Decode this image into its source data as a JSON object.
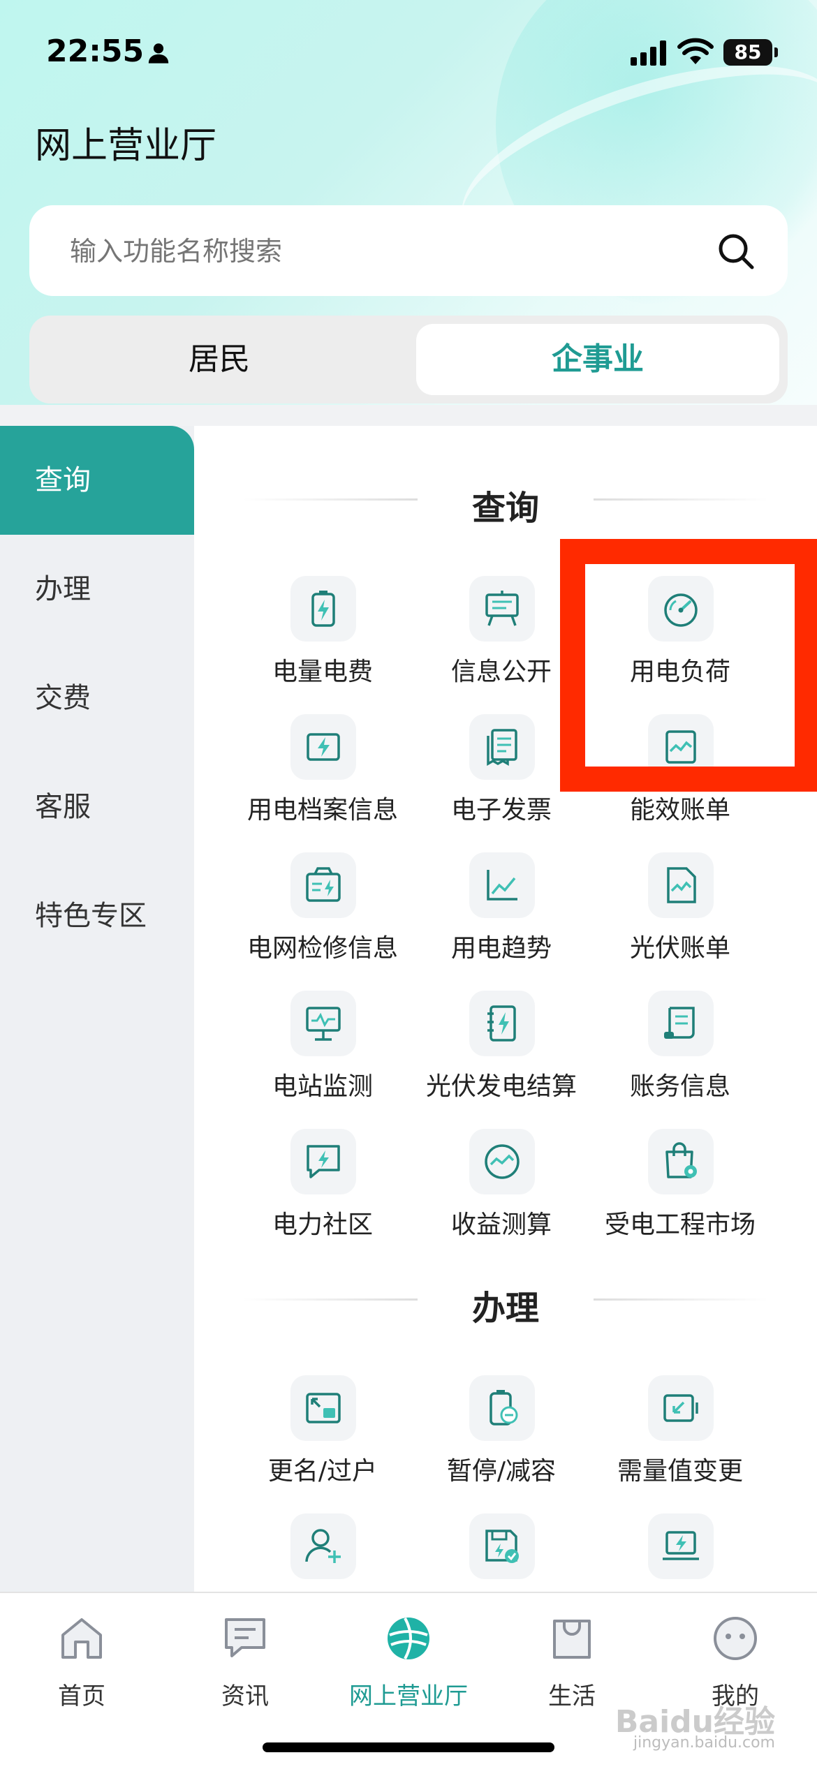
{
  "status_bar": {
    "time": "22:55",
    "battery": "85"
  },
  "page_title": "网上营业厅",
  "search": {
    "placeholder": "输入功能名称搜索"
  },
  "segments": [
    "居民",
    "企事业"
  ],
  "sidebar": {
    "items": [
      "查询",
      "办理",
      "交费",
      "客服",
      "特色专区"
    ],
    "active": "查询"
  },
  "sections": [
    {
      "title": "查询",
      "items": [
        {
          "label": "电量电费",
          "icon": "battery-bolt-icon"
        },
        {
          "label": "信息公开",
          "icon": "easel-board-icon"
        },
        {
          "label": "用电负荷",
          "icon": "speedometer-icon"
        },
        {
          "label": "用电档案信息",
          "icon": "file-bolt-icon"
        },
        {
          "label": "电子发票",
          "icon": "invoice-icon"
        },
        {
          "label": "能效账单",
          "icon": "efficiency-bill-icon"
        },
        {
          "label": "电网检修信息",
          "icon": "maintenance-folder-icon"
        },
        {
          "label": "用电趋势",
          "icon": "trend-chart-icon"
        },
        {
          "label": "光伏账单",
          "icon": "pv-bill-icon"
        },
        {
          "label": "电站监测",
          "icon": "monitor-screen-icon"
        },
        {
          "label": "光伏发电结算",
          "icon": "ledger-bolt-icon"
        },
        {
          "label": "账务信息",
          "icon": "scroll-document-icon"
        },
        {
          "label": "电力社区",
          "icon": "chat-bolt-icon"
        },
        {
          "label": "收益测算",
          "icon": "earnings-gauge-icon"
        },
        {
          "label": "受电工程市场",
          "icon": "shopping-bag-gear-icon"
        }
      ]
    },
    {
      "title": "办理",
      "items": [
        {
          "label": "更名/过户",
          "icon": "transfer-card-icon"
        },
        {
          "label": "暂停/减容",
          "icon": "battery-minus-icon"
        },
        {
          "label": "需量值变更",
          "icon": "demand-change-icon"
        },
        {
          "label": "",
          "icon": "add-person-icon"
        },
        {
          "label": "",
          "icon": "disk-check-icon"
        },
        {
          "label": "",
          "icon": "laptop-bolt-icon"
        }
      ]
    }
  ],
  "tabbar": {
    "items": [
      "首页",
      "资讯",
      "网上营业厅",
      "生活",
      "我的"
    ],
    "active": "网上营业厅"
  },
  "watermark": {
    "text": "Baidu经验",
    "sub": "jingyan.baidu.com"
  },
  "colors": {
    "accent": "#26a39a",
    "highlight_box": "#ff2a00"
  }
}
